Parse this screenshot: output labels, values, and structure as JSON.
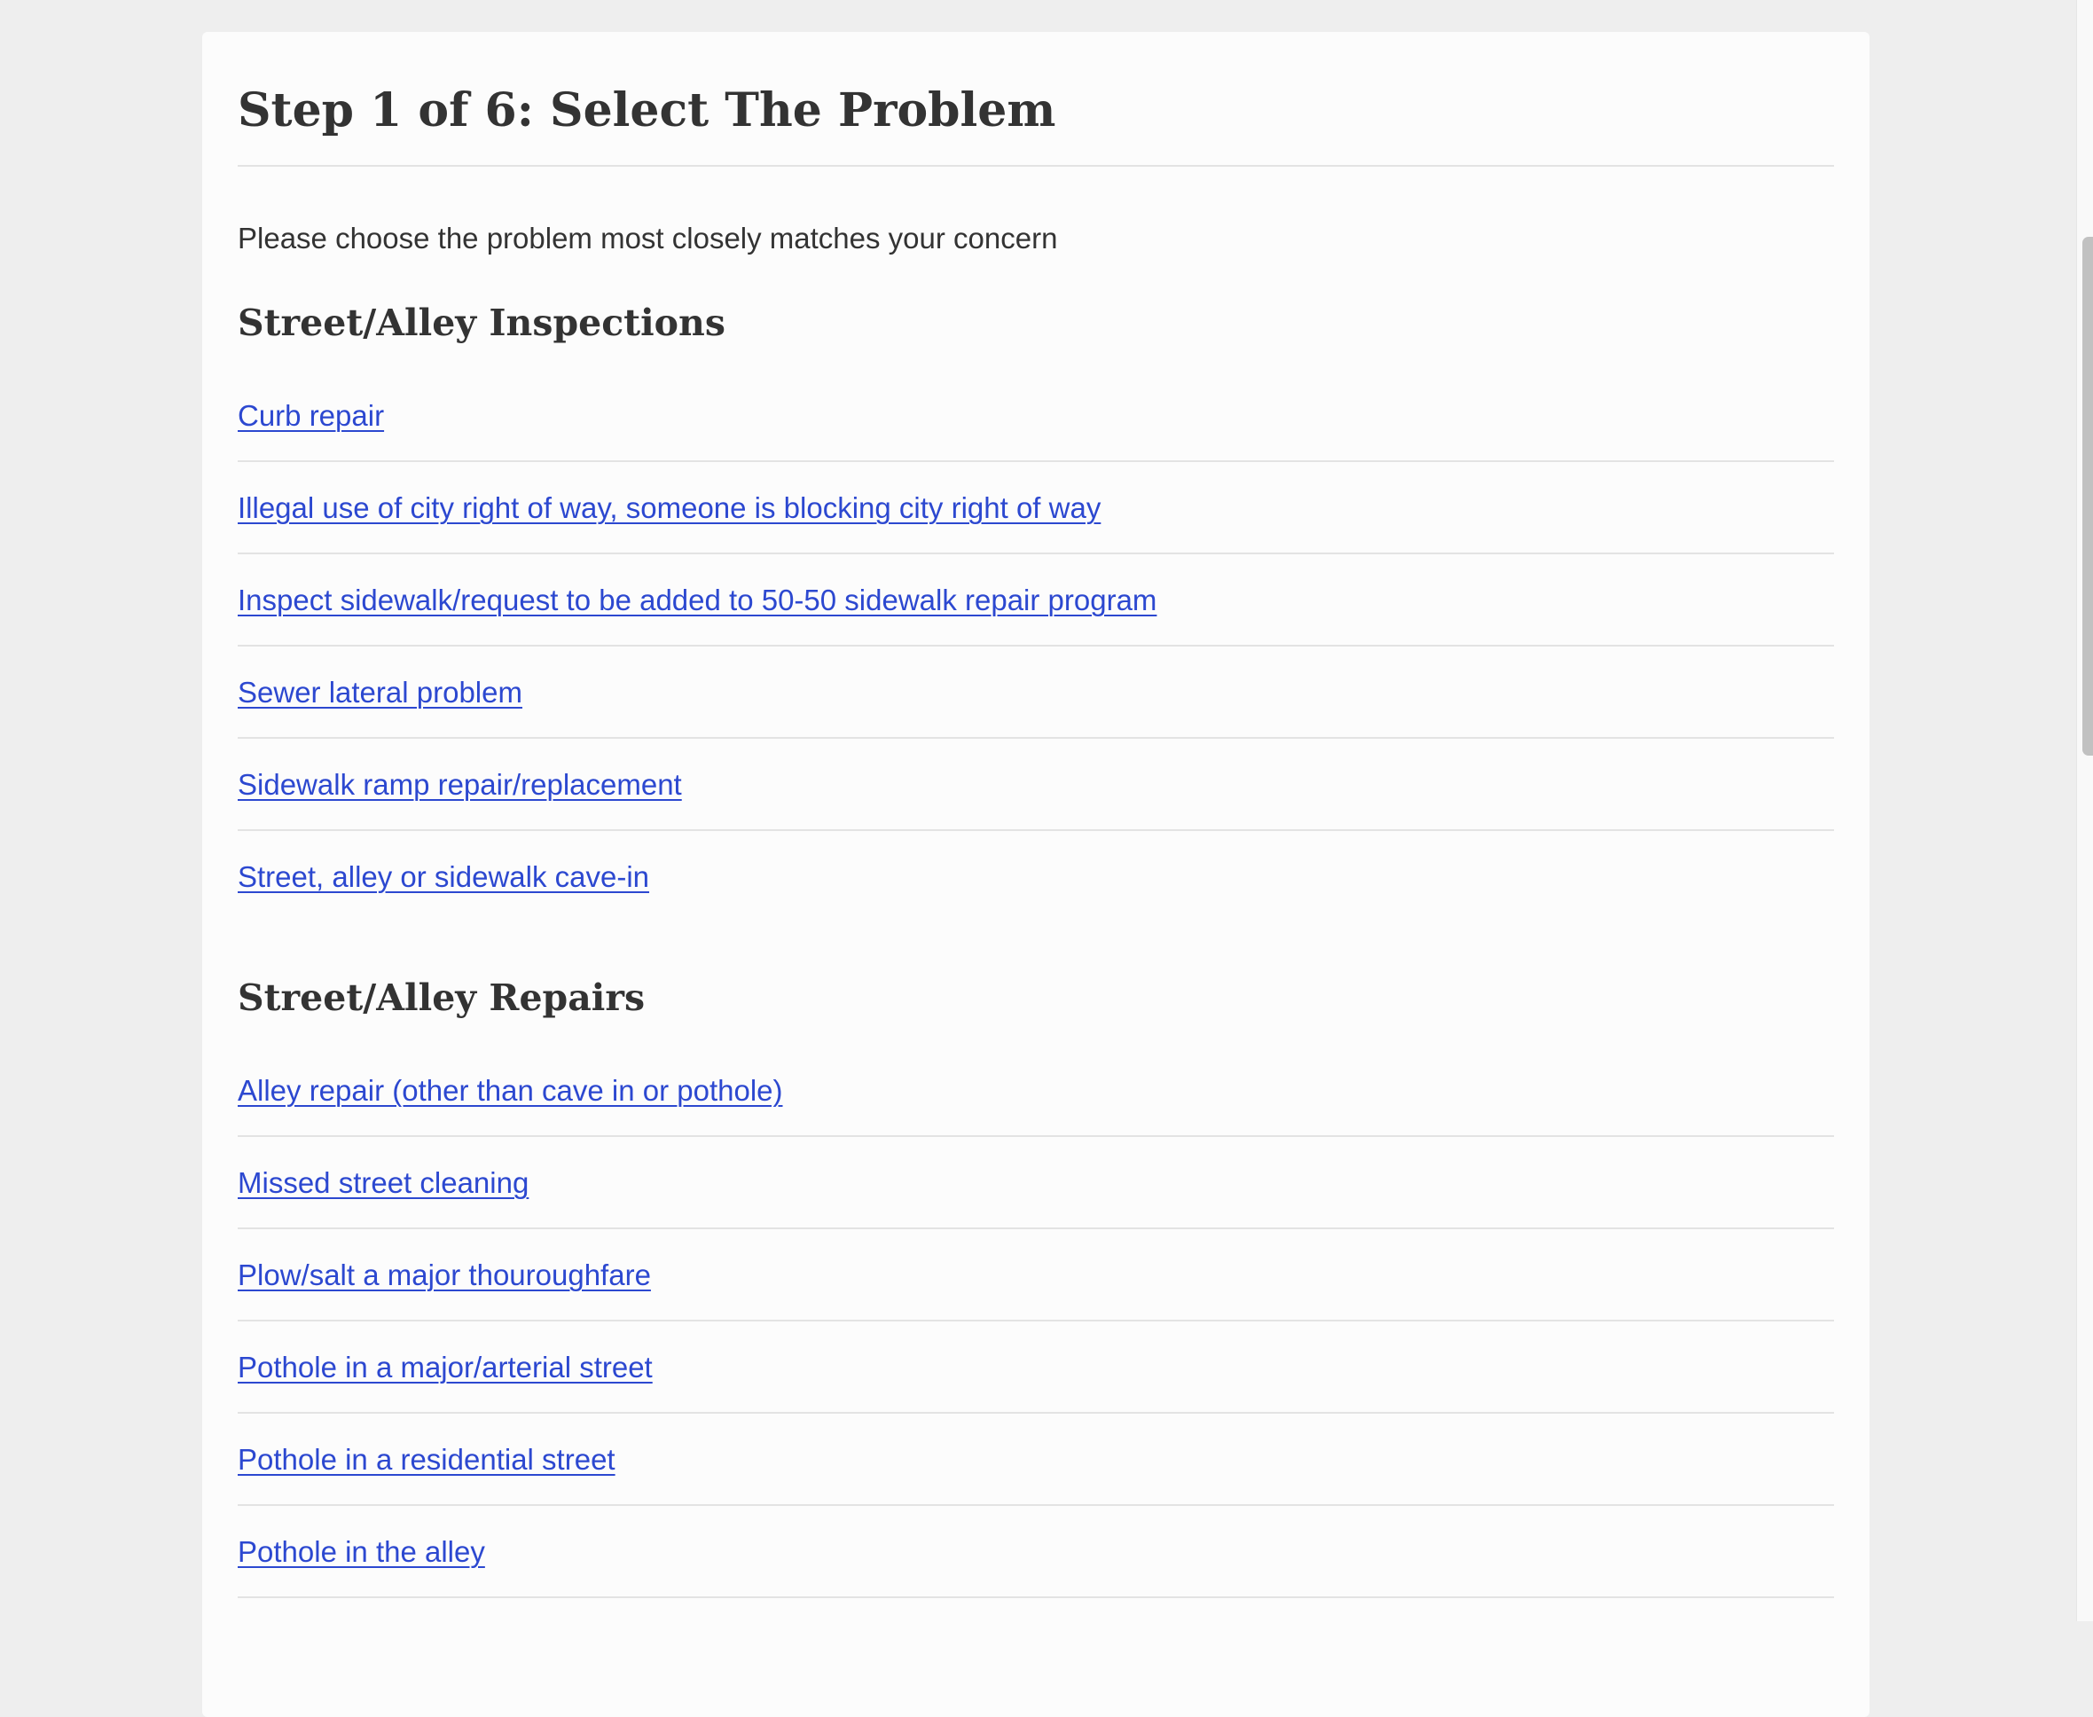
{
  "page": {
    "title": "Step 1 of 6: Select The Problem",
    "intro": "Please choose the problem most closely matches your concern",
    "colors": {
      "background": "#eeeeee",
      "card": "#fcfcfc",
      "text": "#333333",
      "link": "#2c48d0",
      "divider": "#e3e3e3"
    }
  },
  "sections": [
    {
      "heading": "Street/Alley Inspections",
      "items": [
        {
          "label": "Curb repair"
        },
        {
          "label": "Illegal use of city right of way, someone is blocking city right of way"
        },
        {
          "label": "Inspect sidewalk/request to be added to 50-50 sidewalk repair program"
        },
        {
          "label": "Sewer lateral problem"
        },
        {
          "label": "Sidewalk ramp repair/replacement"
        },
        {
          "label": "Street, alley or sidewalk cave-in"
        }
      ]
    },
    {
      "heading": "Street/Alley Repairs",
      "items": [
        {
          "label": "Alley repair (other than cave in or pothole)"
        },
        {
          "label": "Missed street cleaning"
        },
        {
          "label": "Plow/salt a major thouroughfare"
        },
        {
          "label": "Pothole in a major/arterial street"
        },
        {
          "label": "Pothole in a residential street"
        },
        {
          "label": "Pothole in the alley"
        }
      ]
    }
  ]
}
